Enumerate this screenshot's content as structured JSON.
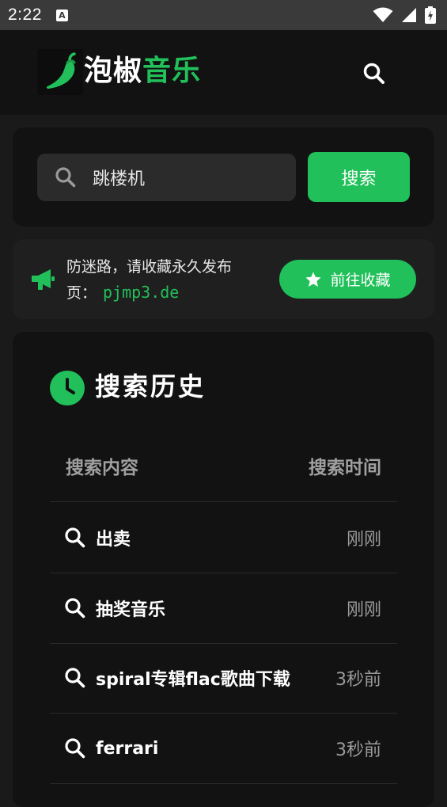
{
  "status_bar": {
    "time": "2:22",
    "a_badge": "A",
    "icons": [
      "wifi-icon",
      "signal-icon",
      "battery-icon"
    ]
  },
  "header": {
    "logo_icon": "chili-pepper-icon",
    "title_part1": "泡椒",
    "title_part2": "音乐",
    "search_icon": "search-icon"
  },
  "search": {
    "query": "跳楼机",
    "button_label": "搜索"
  },
  "notice": {
    "text": "防迷路，请收藏永久发布页：",
    "url": "pjmp3.de",
    "button_label": "前往收藏",
    "icon": "megaphone-icon"
  },
  "history": {
    "title": "搜索历史",
    "col_query": "搜索内容",
    "col_time": "搜索时间",
    "rows": [
      {
        "query": "出卖",
        "time": "刚刚"
      },
      {
        "query": "抽奖音乐",
        "time": "刚刚"
      },
      {
        "query": "spiral专辑flac歌曲下载",
        "time": "3秒前"
      },
      {
        "query": "ferrari",
        "time": "3秒前"
      }
    ]
  },
  "colors": {
    "accent": "#21c05a",
    "background": "#1a1a1a",
    "card": "#121212",
    "status_bar": "#3a3a3a"
  }
}
